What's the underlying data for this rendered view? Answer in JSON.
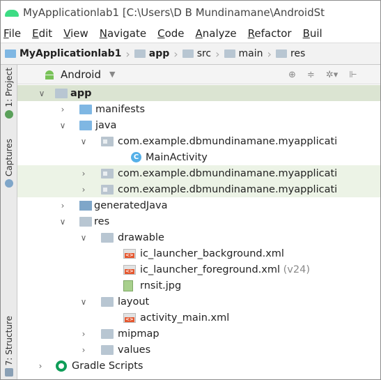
{
  "window": {
    "title": "MyApplicationlab1 [C:\\Users\\D B Mundinamane\\AndroidSt"
  },
  "menu": [
    "File",
    "Edit",
    "View",
    "Navigate",
    "Code",
    "Analyze",
    "Refactor",
    "Buil"
  ],
  "breadcrumb": [
    {
      "label": "MyApplicationlab1",
      "bold": true
    },
    {
      "label": "app",
      "bold": true
    },
    {
      "label": "src",
      "bold": false
    },
    {
      "label": "main",
      "bold": false
    },
    {
      "label": "res",
      "bold": false
    }
  ],
  "side_tabs": {
    "project": "1: Project",
    "captures": "Captures",
    "structure": "7: Structure"
  },
  "panel": {
    "view": "Android",
    "tools": [
      "⊕",
      "≑",
      "✲▾",
      "⊩"
    ]
  },
  "tree": [
    {
      "label": "app",
      "bold": true,
      "icon": "module-folder-icon",
      "chevron": "open",
      "state": "selected"
    },
    {
      "label": "manifests",
      "icon": "folder-icon",
      "chevron": "closed"
    },
    {
      "label": "java",
      "icon": "folder-icon",
      "chevron": "open"
    },
    {
      "label": "com.example.dbmundinamane.myapplicati",
      "icon": "package-icon",
      "chevron": "open"
    },
    {
      "label": "MainActivity",
      "icon": "class-icon",
      "chevron": "none"
    },
    {
      "label": "com.example.dbmundinamane.myapplicati",
      "icon": "package-icon",
      "chevron": "closed",
      "state": "highlight"
    },
    {
      "label": "com.example.dbmundinamane.myapplicati",
      "icon": "package-icon",
      "chevron": "closed",
      "state": "highlight"
    },
    {
      "label": "generatedJava",
      "icon": "generated-folder-icon",
      "chevron": "closed"
    },
    {
      "label": "res",
      "icon": "res-folder-icon",
      "chevron": "open"
    },
    {
      "label": "drawable",
      "icon": "folder-icon",
      "chevron": "open"
    },
    {
      "label": "ic_launcher_background.xml",
      "icon": "xml-file-icon",
      "chevron": "none"
    },
    {
      "label": "ic_launcher_foreground.xml",
      "suffix": "(v24)",
      "icon": "xml-file-icon",
      "chevron": "none"
    },
    {
      "label": "rnsit.jpg",
      "icon": "image-file-icon",
      "chevron": "none"
    },
    {
      "label": "layout",
      "icon": "folder-icon",
      "chevron": "open"
    },
    {
      "label": "activity_main.xml",
      "icon": "xml-file-icon",
      "chevron": "none"
    },
    {
      "label": "mipmap",
      "icon": "folder-icon",
      "chevron": "closed"
    },
    {
      "label": "values",
      "icon": "folder-icon",
      "chevron": "closed"
    },
    {
      "label": "Gradle Scripts",
      "icon": "gradle-icon",
      "chevron": "closed"
    }
  ]
}
